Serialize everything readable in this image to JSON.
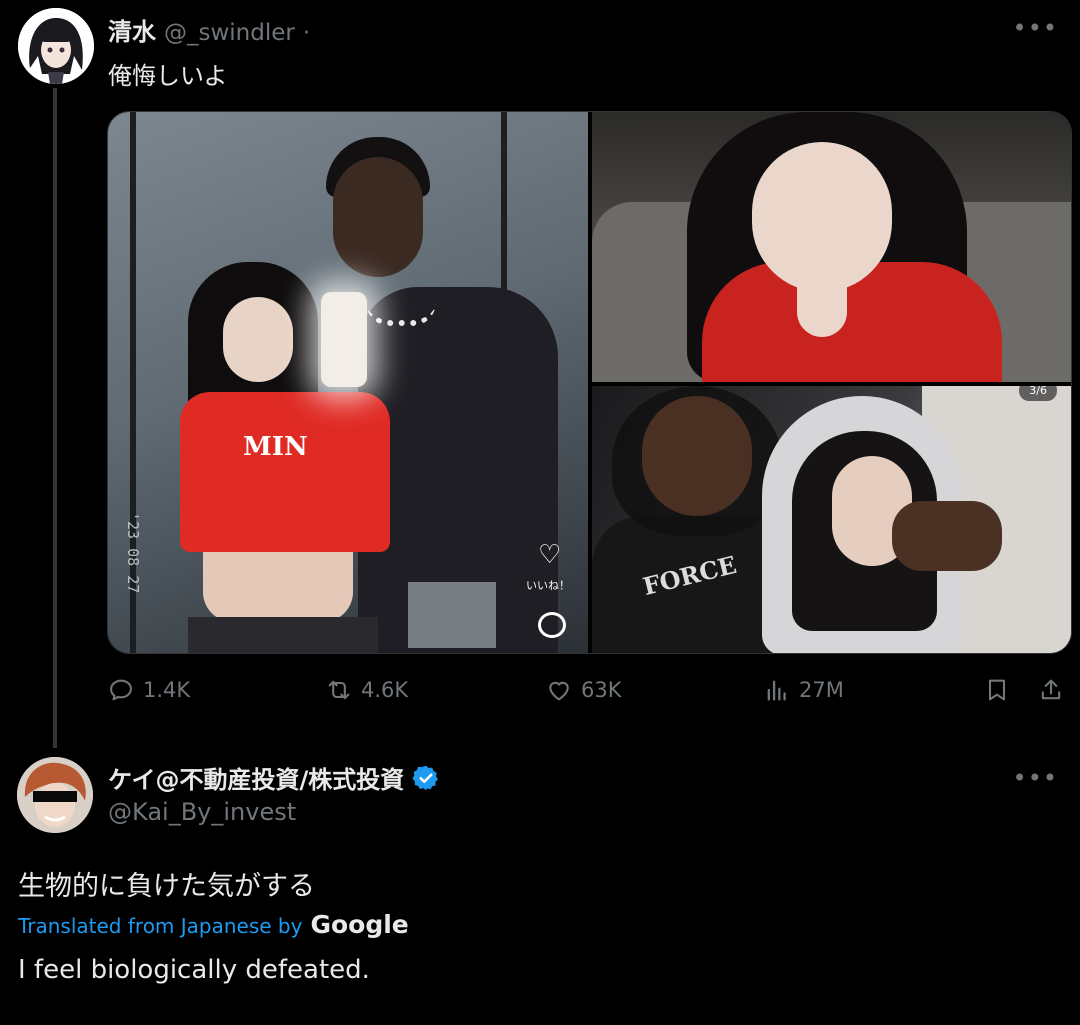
{
  "tweet1": {
    "display_name": "清水",
    "handle": "@_swindler",
    "separator": "·",
    "text": "俺悔しいよ",
    "media": {
      "main_photo_shirt_text": "MIN",
      "main_photo_date_stamp": "'23 08 27",
      "main_photo_like_label": "いいね！",
      "bottom_right_counter": "3/6",
      "bottom_right_shirt_text": "FORCE"
    },
    "actions": {
      "replies": "1.4K",
      "reposts": "4.6K",
      "likes": "63K",
      "views": "27M"
    },
    "more_icon": "more-horizontal-icon"
  },
  "tweet2": {
    "display_name": "ケイ@不動産投資/株式投資",
    "verified": true,
    "handle": "@Kai_By_invest",
    "text": "生物的に負けた気がする",
    "translated_label": "Translated from Japanese by",
    "translated_brand": "Google",
    "translation": "I feel biologically defeated.",
    "more_icon": "more-horizontal-icon"
  },
  "colors": {
    "background": "#000000",
    "primary_text": "#e7e9ea",
    "secondary_text": "#71767b",
    "link_blue": "#1d9bf0",
    "verified_blue": "#1d9bf0",
    "thread_line": "#333639"
  }
}
